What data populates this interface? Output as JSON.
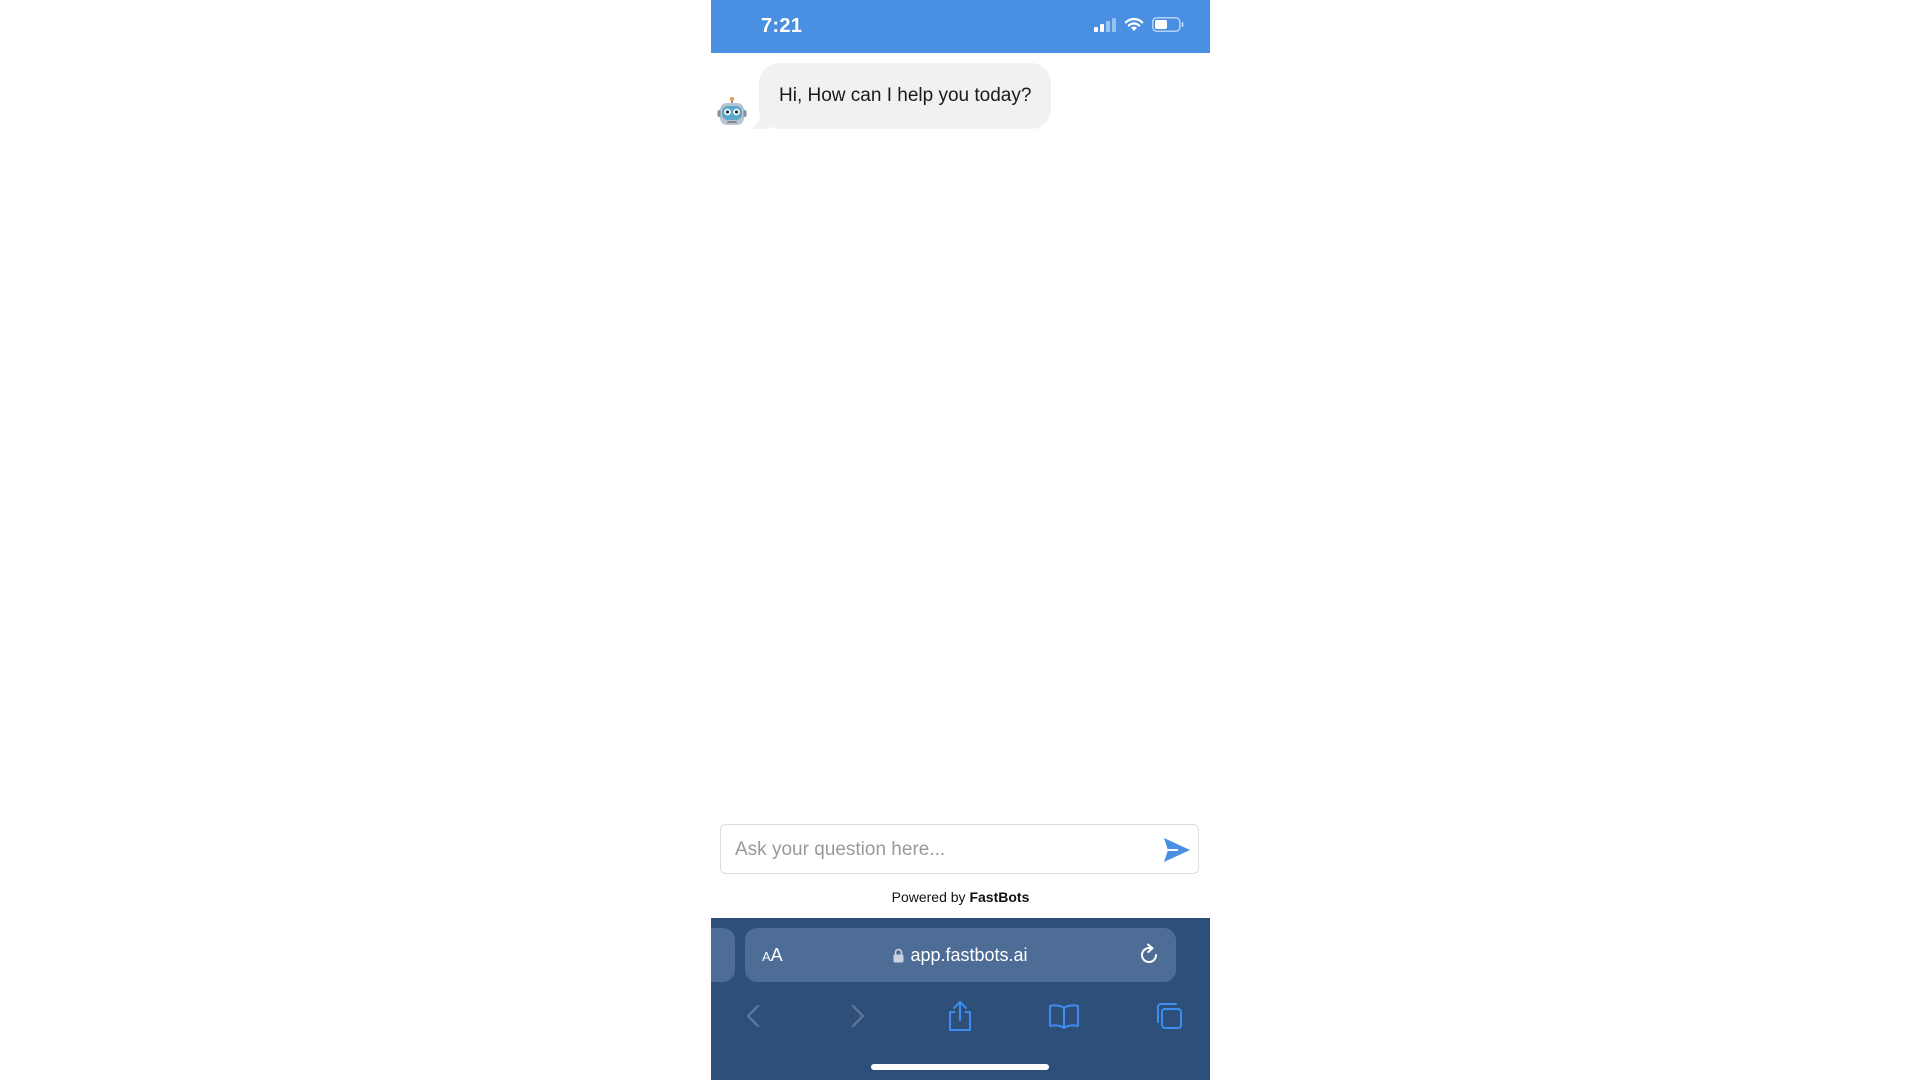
{
  "status_bar": {
    "time": "7:21",
    "icons": [
      "cellular-signal-icon",
      "wifi-icon",
      "battery-icon"
    ]
  },
  "chat": {
    "messages": [
      {
        "sender": "bot",
        "avatar_icon": "robot-icon",
        "text": "Hi, How can I help you today?"
      }
    ]
  },
  "composer": {
    "placeholder": "Ask your question here...",
    "send_icon": "send-icon"
  },
  "footer": {
    "powered_prefix": "Powered by",
    "powered_brand": "FastBots"
  },
  "browser": {
    "text_size_label_small": "A",
    "text_size_label_large": "A",
    "url": "app.fastbots.ai",
    "lock_icon": "lock-icon",
    "reload_icon": "reload-icon",
    "toolbar_icons": [
      "back-icon",
      "forward-icon",
      "share-icon",
      "bookmarks-icon",
      "tabs-icon"
    ]
  },
  "colors": {
    "accent": "#4a90e2",
    "bubble_bg": "#f1f1f1",
    "browser_bar": "#2d4f7a",
    "url_bar": "#4e6d96"
  }
}
